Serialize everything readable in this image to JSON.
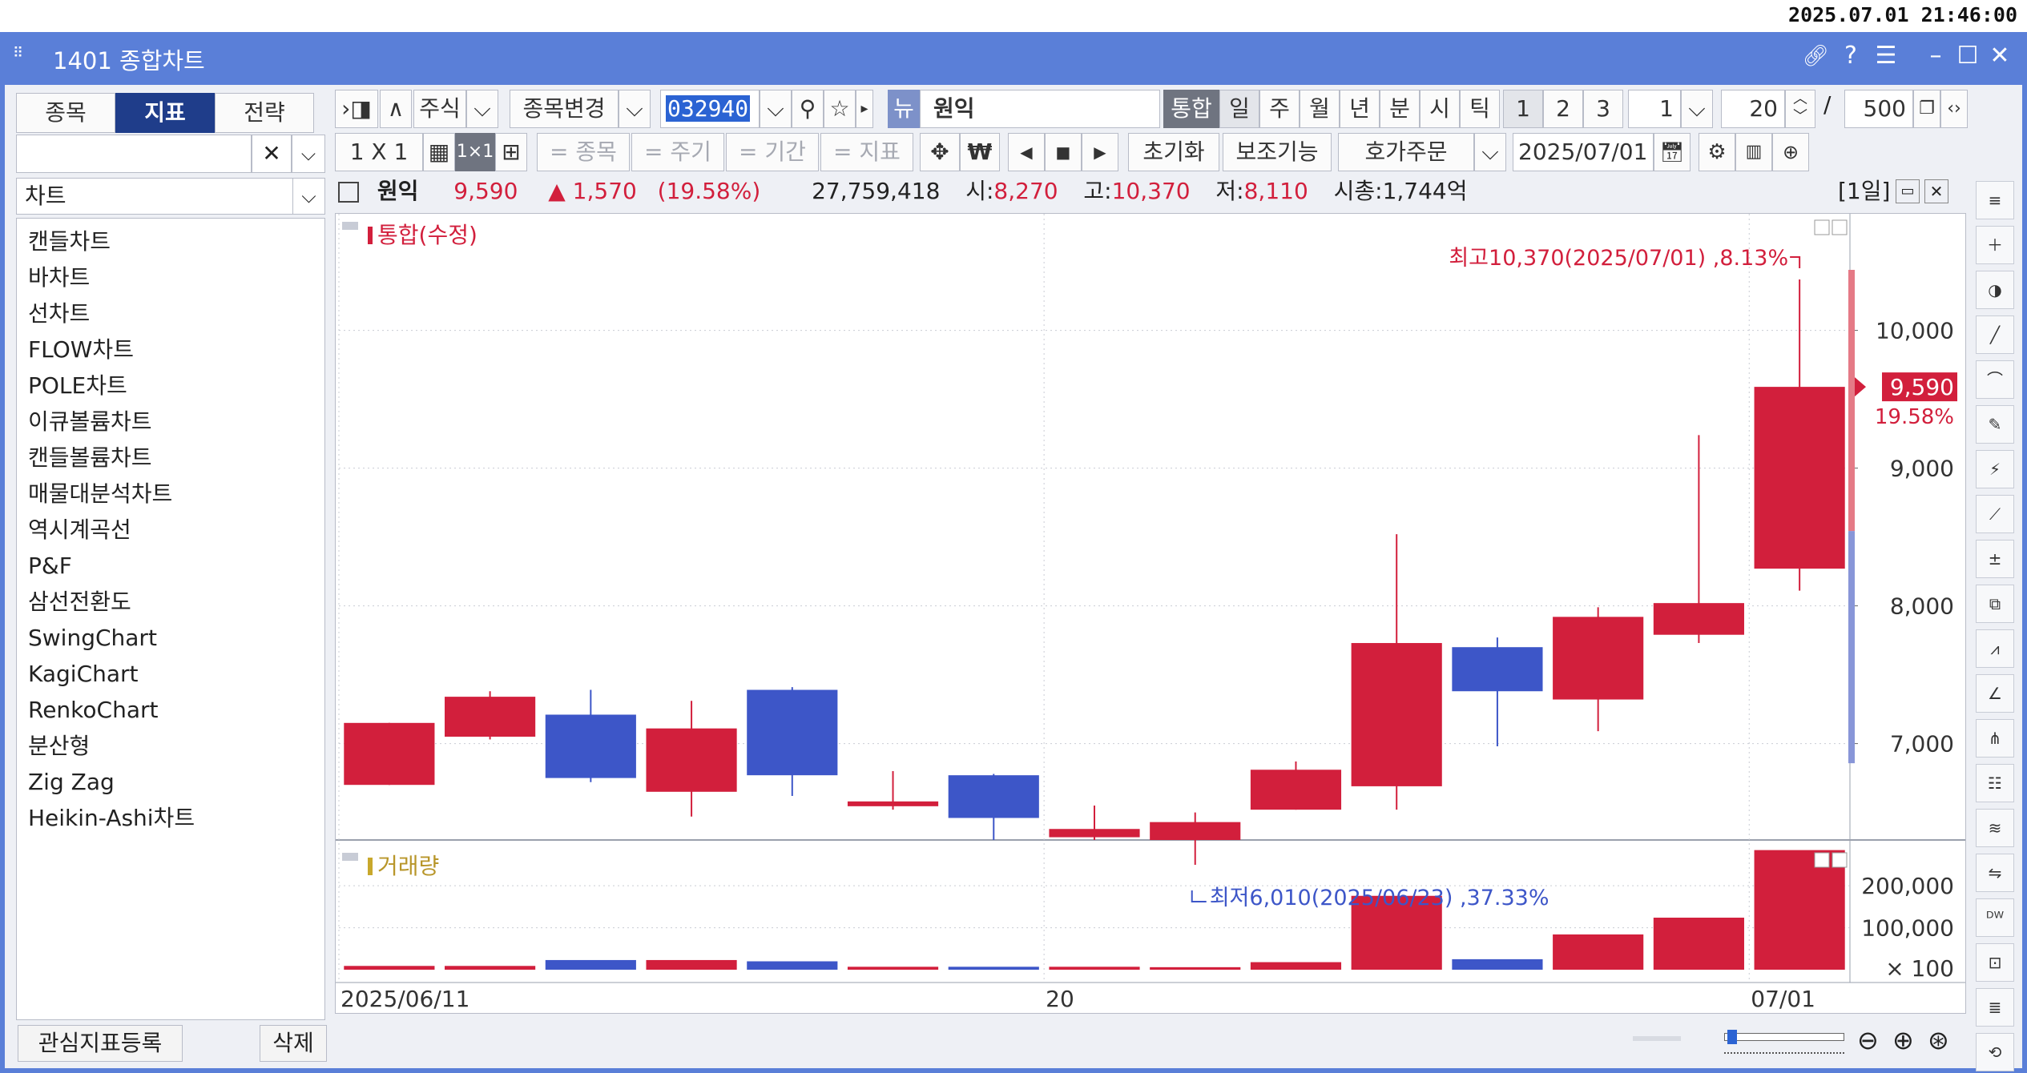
{
  "clock": "2025.07.01 21:46:00",
  "window": {
    "title": "1401 종합차트"
  },
  "left_panel": {
    "tabs": [
      "종목",
      "지표",
      "전략"
    ],
    "active_tab": 1,
    "category": "차트",
    "items": [
      "캔들차트",
      "바차트",
      "선차트",
      "FLOW차트",
      "POLE차트",
      "이큐볼륨차트",
      "캔들볼륨차트",
      "매물대분석차트",
      "역시계곡선",
      "P&F",
      "삼선전환도",
      "SwingChart",
      "KagiChart",
      "RenkoChart",
      "분산형",
      "Zig Zag",
      "Heikin-Ashi차트"
    ],
    "register_btn": "관심지표등록",
    "delete_btn": "삭제"
  },
  "toolbar1": {
    "market": "주식",
    "change": "종목변경",
    "code": "032940",
    "new_badge": "뉴",
    "name": "원익",
    "combined": "통합",
    "periods": [
      "일",
      "주",
      "월",
      "년",
      "분",
      "시",
      "틱"
    ],
    "page_buttons": [
      "1",
      "2",
      "3"
    ],
    "interval": "1",
    "count": "20",
    "slash": "/",
    "total": "500"
  },
  "toolbar2": {
    "layout": "1 X 1",
    "grid_label": "1×1",
    "filters": [
      "= 종목",
      "= 주기",
      "= 기간",
      "= 지표"
    ],
    "reset": "초기화",
    "aux": "보조기능",
    "order": "호가주문",
    "date": "2025/07/01"
  },
  "info": {
    "name": "원익",
    "price": "9,590",
    "change": "▲ 1,570",
    "change_pct": "(19.58%)",
    "volume": "27,759,418",
    "open_label": "시:",
    "open": "8,270",
    "high_label": "고:",
    "high": "10,370",
    "low_label": "저:",
    "low": "8,110",
    "cap_label": "시총:",
    "cap": "1,744억",
    "period_tag": "[1일]"
  },
  "chart_data": {
    "type": "candlestick",
    "price_panel_title": "통합(수정)",
    "volume_panel_title": "거래량",
    "y_ticks": [
      "10,000",
      "9,000",
      "8,000",
      "7,000"
    ],
    "y_tick_values": [
      10000,
      9000,
      8000,
      7000
    ],
    "y_range": [
      6300,
      10800
    ],
    "vol_ticks": [
      "200,000",
      "100,000"
    ],
    "vol_tick_values": [
      200000,
      100000
    ],
    "vol_unit": "× 100",
    "vol_range": [
      0,
      290000
    ],
    "x_labels": [
      "2025/06/11",
      "20",
      "07/01"
    ],
    "x_label_index": [
      0,
      7,
      14
    ],
    "current_price_label": "9,590",
    "current_pct_label": "19.58%",
    "current_price": 9590,
    "high_annotation": "최고10,370(2025/07/01) ,8.13%",
    "low_annotation": "최저6,010(2025/06/23) ,37.33%",
    "candles": [
      {
        "o": 6700,
        "h": 7150,
        "l": 6700,
        "c": 7150,
        "v": 9000
      },
      {
        "o": 7050,
        "h": 7380,
        "l": 7030,
        "c": 7340,
        "v": 9000
      },
      {
        "o": 7210,
        "h": 7390,
        "l": 6720,
        "c": 6750,
        "v": 23000
      },
      {
        "o": 6650,
        "h": 7310,
        "l": 6470,
        "c": 7110,
        "v": 23000
      },
      {
        "o": 7390,
        "h": 7410,
        "l": 6620,
        "c": 6770,
        "v": 20000
      },
      {
        "o": 6580,
        "h": 6800,
        "l": 6520,
        "c": 6580,
        "v": 7000
      },
      {
        "o": 6770,
        "h": 6780,
        "l": 6300,
        "c": 6460,
        "v": 7000
      },
      {
        "o": 6320,
        "h": 6550,
        "l": 6300,
        "c": 6380,
        "v": 7000
      },
      {
        "o": 6300,
        "h": 6500,
        "l": 6120,
        "c": 6430,
        "v": 6000
      },
      {
        "o": 6520,
        "h": 6870,
        "l": 6520,
        "c": 6810,
        "v": 18000
      },
      {
        "o": 6690,
        "h": 8520,
        "l": 6520,
        "c": 7730,
        "v": 176000
      },
      {
        "o": 7700,
        "h": 7770,
        "l": 6980,
        "c": 7380,
        "v": 25000
      },
      {
        "o": 7320,
        "h": 7990,
        "l": 7090,
        "c": 7920,
        "v": 84000
      },
      {
        "o": 7790,
        "h": 9240,
        "l": 7730,
        "c": 8020,
        "v": 124000
      },
      {
        "o": 8270,
        "h": 10370,
        "l": 8110,
        "c": 9590,
        "v": 285000
      }
    ],
    "up_color": "#d21f3c",
    "down_color": "#3d56c8"
  }
}
